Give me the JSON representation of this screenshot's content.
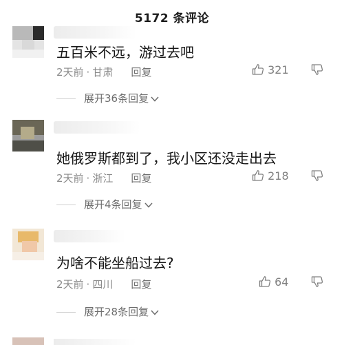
{
  "header": {
    "title": "5172 条评论"
  },
  "comments": [
    {
      "text": "五百米不远，游过去吧",
      "time": "2天前",
      "location": "甘肃",
      "reply_label": "回复",
      "likes": "321",
      "expand": "展开36条回复"
    },
    {
      "text": "她俄罗斯都到了，我小区还没走出去",
      "time": "2天前",
      "location": "浙江",
      "reply_label": "回复",
      "likes": "218",
      "expand": "展开4条回复"
    },
    {
      "text": "为啥不能坐船过去?",
      "time": "2天前",
      "location": "四川",
      "reply_label": "回复",
      "likes": "64",
      "expand": "展开28条回复"
    }
  ],
  "meta_separator": "·",
  "icons": {
    "like": "thumbs-up-icon",
    "dislike": "thumbs-down-icon",
    "expand": "chevron-down-icon"
  },
  "colors": {
    "text": "#161616",
    "meta": "#8a8a8a",
    "background": "#ffffff"
  }
}
